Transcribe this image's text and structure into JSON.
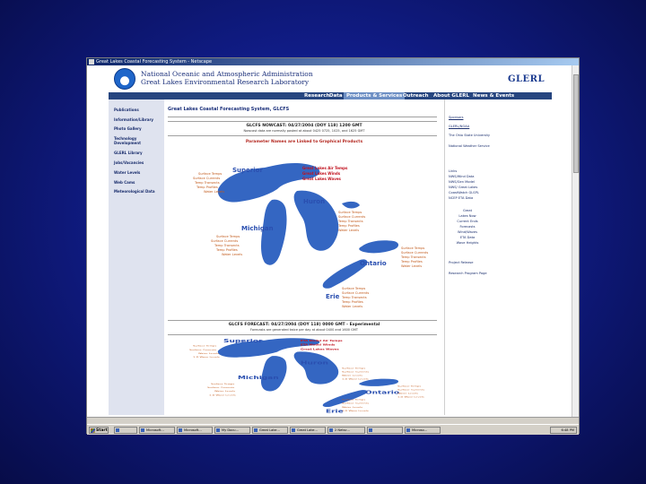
{
  "window": {
    "title": "Great Lakes Coastal Forecasting System - Netscape"
  },
  "banner": {
    "org_name": "National Oceanic and Atmospheric Administration",
    "lab_name": "Great Lakes Environmental Research Laboratory",
    "logo_text": "GLERL"
  },
  "nav": {
    "tabs": [
      {
        "label": "Research"
      },
      {
        "label": "Data"
      },
      {
        "label": "Products & Services"
      },
      {
        "label": "Outreach"
      },
      {
        "label": "About GLERL"
      },
      {
        "label": "News & Events"
      }
    ],
    "active_index": 2
  },
  "sidebar": {
    "items": [
      {
        "label": "Publications"
      },
      {
        "label": "Information/Library"
      },
      {
        "label": "Photo Gallery"
      },
      {
        "label": "Technology"
      },
      {
        "label": "Development"
      },
      {
        "label": "GLERL Library"
      },
      {
        "label": "Jobs/Vacancies"
      },
      {
        "label": "Water Levels"
      },
      {
        "label": "Web Cams"
      },
      {
        "label": "Meteorological Data"
      }
    ]
  },
  "main": {
    "page_title": "Great Lakes Coastal Forecasting System, GLCFS",
    "nowcast": {
      "header": "GLCFS NOWCAST: 04/27/2004 (DOY 118) 1200 GMT",
      "sub": "Nowcast data are normally posted at about 0425 0725, 1025, and 1625 GMT",
      "param_note": "Parameter Names are Linked to Graphical Products"
    },
    "forecast": {
      "header": "GLCFS FORECAST: 04/27/2004 (DOY 118) 0000 GMT - Experimental",
      "sub": "Forecasts are generated twice per day at about 0400 and 1600 GMT"
    },
    "lakes": [
      "Superior",
      "Michigan",
      "Huron",
      "Ontario",
      "Erie"
    ],
    "nowcast_map": {
      "lake_wide": [
        "Great Lakes Air Temps",
        "Great Lakes Winds",
        "Great Lakes Waves"
      ],
      "superior_params": [
        "Surface Temps",
        "Surface Currents",
        "Temp Transects",
        "Temp Profiles",
        "Water Levels"
      ],
      "huron_params": [
        "Surface Temps",
        "Surface Currents",
        "Temp Transects",
        "Temp Profiles",
        "Water Levels"
      ],
      "michigan_params": [
        "Surface Temps",
        "Surface Currents",
        "Temp Transects",
        "Temp Profiles",
        "Water Levels"
      ],
      "ontario_params": [
        "Surface Temps",
        "Surface Currents",
        "Temp Transects",
        "Temp Profiles",
        "Water Levels"
      ],
      "erie_params": [
        "Surface Temps",
        "Surface Currents",
        "Temp Transects",
        "Temp Profiles",
        "Water Levels"
      ]
    },
    "forecast_map": {
      "lake_wide": [
        "ETA Model Air Temps",
        "ETA Model Winds",
        "Great Lakes Waves"
      ],
      "superior_params": [
        "Surface Temps",
        "Surface Currents",
        "Water Levels",
        "1-D Wave Levels"
      ],
      "huron_params": [
        "Surface Temps",
        "Surface Currents",
        "Water Levels",
        "1-D Wave Levels"
      ],
      "michigan_params": [
        "Surface Temps",
        "Surface Currents",
        "Water Levels",
        "1-D Wave Levels"
      ],
      "ontario_params": [
        "Surface Temps",
        "Surface Currents",
        "Water Levels",
        "1-D Wave Levels"
      ],
      "erie_params": [
        "Surface Temps",
        "Surface Currents",
        "Water Levels",
        "1-D Wave Levels"
      ]
    }
  },
  "rightcol": {
    "sponsors_label": "Sponsors",
    "partner_label": "GLERL/NOAA",
    "osu": "The Ohio State University",
    "nws": "National Weather Service",
    "links_label": "Links",
    "links": [
      "NWS/Wind Data",
      "NWS/Gen Model",
      "NWS/ Great Lakes",
      "CoastWatch GLSPL",
      "NCEP ETA Data"
    ],
    "center_lines": [
      "Great",
      "Lakes Now",
      "Current Ends",
      "Forecasts",
      "Wind/Waves",
      "ETA Data",
      "Wave Heights"
    ],
    "bottom_links": [
      "Project Release",
      "Research Program Page"
    ]
  },
  "taskbar": {
    "start_label": "Start",
    "tasks": [
      "",
      "Microsoft...",
      "Microsoft...",
      "My Docu...",
      "Great Lake...",
      "Great Lake...",
      "2 Netsc...",
      "",
      "Microso..."
    ],
    "clock": "6:48 PM"
  },
  "colors": {
    "accent": "#26457f",
    "link_red": "#c1121f",
    "lake_blue": "#2a4fb0"
  }
}
